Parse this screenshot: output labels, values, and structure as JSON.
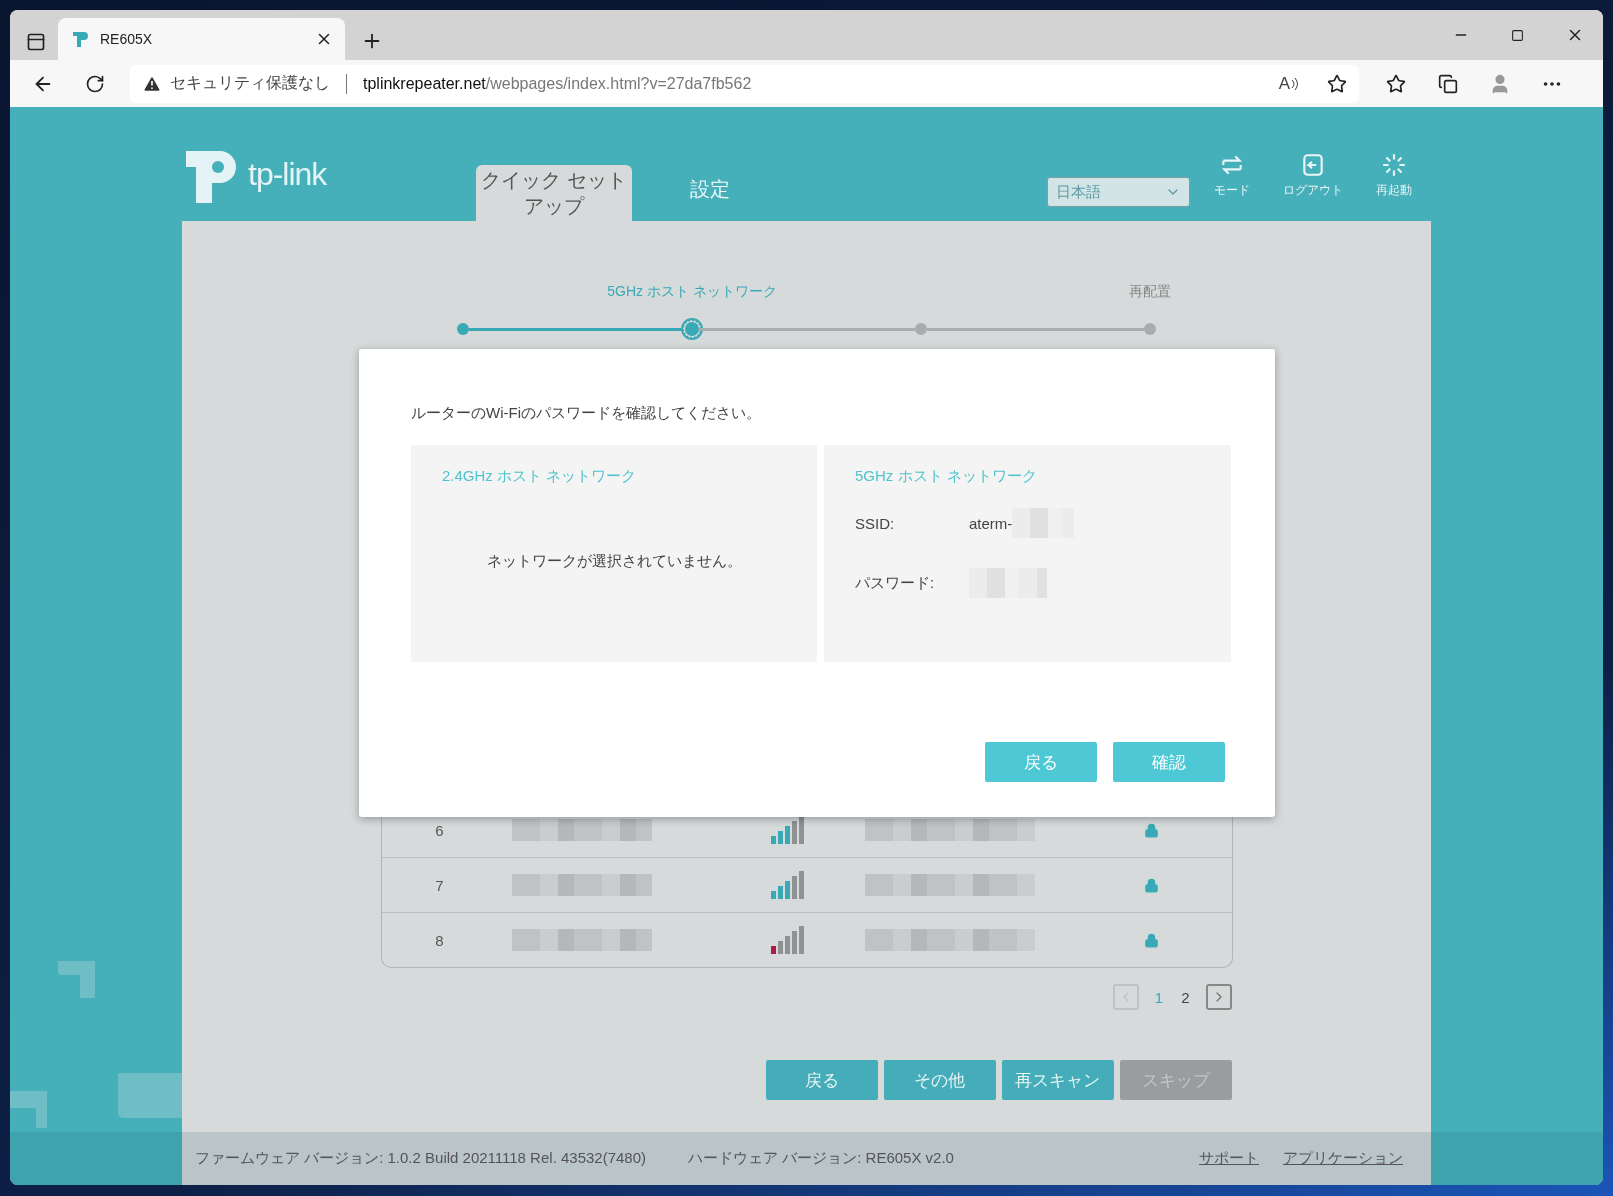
{
  "browser": {
    "tab_title": "RE605X",
    "security_label": "セキュリティ保護なし",
    "url_host": "tplinkrepeater.net",
    "url_path": "/webpages/index.html?v=27da7fb562",
    "read_aloud": "A"
  },
  "header": {
    "logo_text": "tp-link",
    "nav_tabs": [
      {
        "label": "クイック セットアップ",
        "selected": true
      },
      {
        "label": "設定",
        "selected": false
      }
    ],
    "language": "日本語",
    "actions": [
      {
        "kind": "mode",
        "label": "モード"
      },
      {
        "kind": "logout",
        "label": "ログアウト"
      },
      {
        "kind": "reboot",
        "label": "再起動"
      }
    ]
  },
  "steps": [
    {
      "completed": true,
      "selected": false
    },
    {
      "completed": true,
      "selected": true,
      "label": "5GHz ホスト ネットワーク"
    },
    {
      "completed": false,
      "selected": false
    },
    {
      "completed": false,
      "selected": false,
      "label": "再配置"
    }
  ],
  "table": {
    "rows": [
      {
        "number": "6",
        "kind": "good"
      },
      {
        "number": "7",
        "kind": "good"
      },
      {
        "number": "8",
        "kind": "weak"
      }
    ]
  },
  "pagination": {
    "pages": [
      {
        "label": "1",
        "selected": true
      },
      {
        "label": "2",
        "selected": false
      }
    ]
  },
  "buttons": [
    {
      "label": "戻る",
      "disabled": false
    },
    {
      "label": "その他",
      "disabled": false
    },
    {
      "label": "再スキャン",
      "disabled": false
    },
    {
      "label": "スキップ",
      "disabled": true
    }
  ],
  "modal": {
    "prompt": "ルーターのWi-Fiのパスワードを確認してください。",
    "cards": [
      {
        "kind": "empty",
        "title": "2.4GHz ホスト ネットワーク",
        "message": "ネットワークが選択されていません。"
      },
      {
        "kind": "details",
        "title": "5GHz ホスト ネットワーク",
        "fields": [
          {
            "label": "SSID:",
            "value": "aterm-"
          },
          {
            "label": "パスワード:"
          }
        ]
      }
    ],
    "buttons": [
      "戻る",
      "確認"
    ]
  },
  "footer": {
    "firmware": "ファームウェア バージョン: 1.0.2 Build 20211118 Rel. 43532(7480)",
    "hardware": "ハードウェア バージョン: RE605X v2.0",
    "links": [
      "サポート",
      "アプリケーション"
    ]
  }
}
